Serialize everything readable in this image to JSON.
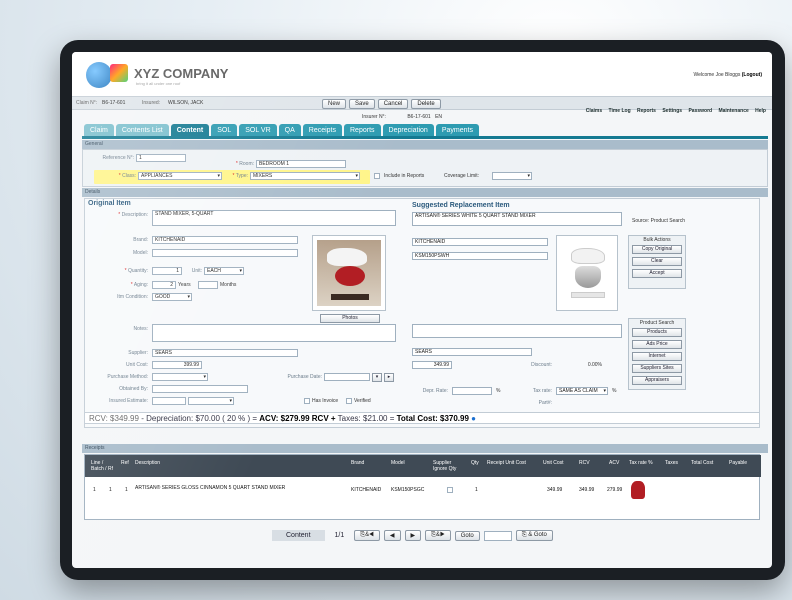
{
  "company": {
    "name": "XYZ COMPANY",
    "tagline": "bring it all under one roof"
  },
  "header": {
    "claim_label": "Claim N°:",
    "claim_no": "B6-17-601",
    "insured_label": "Insured:",
    "insured_name": "WILSON, JACK",
    "insurer_label": "Insurer N°:",
    "insurer_no": "B6-17-601",
    "insurer_suffix": "EN",
    "welcome": "Welcome Joe Bloggs",
    "logout": "(Logout)"
  },
  "toolbar": {
    "new": "New",
    "save": "Save",
    "cancel": "Cancel",
    "delete": "Delete"
  },
  "toplinks": [
    "Claims",
    "Time Log",
    "Reports",
    "Settings",
    "Password",
    "Maintenance",
    "Help"
  ],
  "tabs": [
    {
      "label": "Claim",
      "state": "dim"
    },
    {
      "label": "Contents List",
      "state": "dim"
    },
    {
      "label": "Content",
      "state": "active"
    },
    {
      "label": "SOL",
      "state": "normal"
    },
    {
      "label": "SOL VR",
      "state": "normal"
    },
    {
      "label": "QA",
      "state": "normal"
    },
    {
      "label": "Receipts",
      "state": "normal"
    },
    {
      "label": "Reports",
      "state": "normal"
    },
    {
      "label": "Depreciation",
      "state": "normal"
    },
    {
      "label": "Payments",
      "state": "normal"
    }
  ],
  "general": {
    "section": "General",
    "reference_label": "Reference N°:",
    "reference_value": "1",
    "room_label": "Room:",
    "room_value": "BEDROOM 1",
    "class_label": "Class:",
    "class_value": "APPLIANCES",
    "type_label": "Type:",
    "type_value": "MIXERS",
    "include_label": "Include in Reports",
    "coverage_label": "Coverage Limit:"
  },
  "details": {
    "section": "Details"
  },
  "original": {
    "title": "Original Item",
    "description_label": "Description:",
    "description": "STAND MIXER, 5-QUART",
    "brand_label": "Brand:",
    "brand": "KITCHENAID",
    "model_label": "Model:",
    "quantity_label": "Quantity:",
    "quantity": "1",
    "unit_label": "Unit:",
    "unit": "EACH",
    "aging_label": "Aging:",
    "aging_years": "2",
    "years_label": "Years",
    "months_label": "Months",
    "condition_label": "Itm Condition:",
    "condition": "GOOD",
    "photos_btn": "Photos",
    "notes_label": "Notes:",
    "supplier_label": "Supplier:",
    "supplier": "SEARS",
    "unit_cost_label": "Unit Cost:",
    "unit_cost": "399.99",
    "purchase_method_label": "Purchase Method:",
    "purchase_date_label": "Purchase Date:",
    "obtained_label": "Obtained By:",
    "insured_estimate_label": "Insured Estimate:",
    "has_invoice": "Has Invoice",
    "verified": "Verified"
  },
  "replacement": {
    "title": "Suggested Replacement Item",
    "description": "ARTISAN® SERIES WHITE 5 QUART STAND MIXER",
    "source_label": "Source:",
    "source": "Product Search",
    "brand": "KITCHENAID",
    "model": "KSM150PSWH",
    "bulk_title": "Bulk Actions",
    "copy_original": "Copy Original",
    "clear": "Clear",
    "accept": "Accept",
    "product_search_title": "Product Search",
    "products": "Products",
    "ads_price": "Ads Price",
    "internet": "Internet",
    "suppliers_sites": "Suppliers Sites",
    "appraisers": "Appraisers",
    "supplier": "SEARS",
    "cost": "349.99",
    "discount_label": "Discount:",
    "discount": "0.00%",
    "depr_rate_label": "Depr. Rate:",
    "pct": "%",
    "tax_rate_label": "Tax rate:",
    "tax_rate": "SAME AS CLAIM",
    "part_label": "Part#:"
  },
  "totals": {
    "rcv": "RCV: $349.99",
    "depr": "- Depreciation: $70.00 ( 20 % ) =",
    "acv": "ACV: $279.99",
    "rcv_plus": "RCV +",
    "taxes": "Taxes: $21.00 =",
    "total": "Total Cost: $370.99"
  },
  "receipts": {
    "section": "Receipts",
    "columns": [
      "Line / Batch / Rf",
      "Ref",
      "Description",
      "Brand",
      "Model",
      "Supplier Ignore Qty",
      "Qty",
      "Receipt Unit Cost",
      "Unit Cost",
      "RCV",
      "ACV",
      "Tax rate %",
      "Taxes",
      "Total Cost",
      "Payable"
    ],
    "row": {
      "line": "1",
      "batch": "1",
      "ref": "1",
      "description": "ARTISAN® SERIES GLOSS CINNAMON 5 QUART STAND MIXER",
      "brand": "KITCHENAID",
      "model": "KSM150PSGC",
      "qty": "1",
      "unit_cost": "349.99",
      "rcv": "349.99",
      "acv": "279.99"
    }
  },
  "pager": {
    "label": "Content",
    "position": "1/1",
    "goto": "Goto",
    "save_goto": "& Goto"
  }
}
